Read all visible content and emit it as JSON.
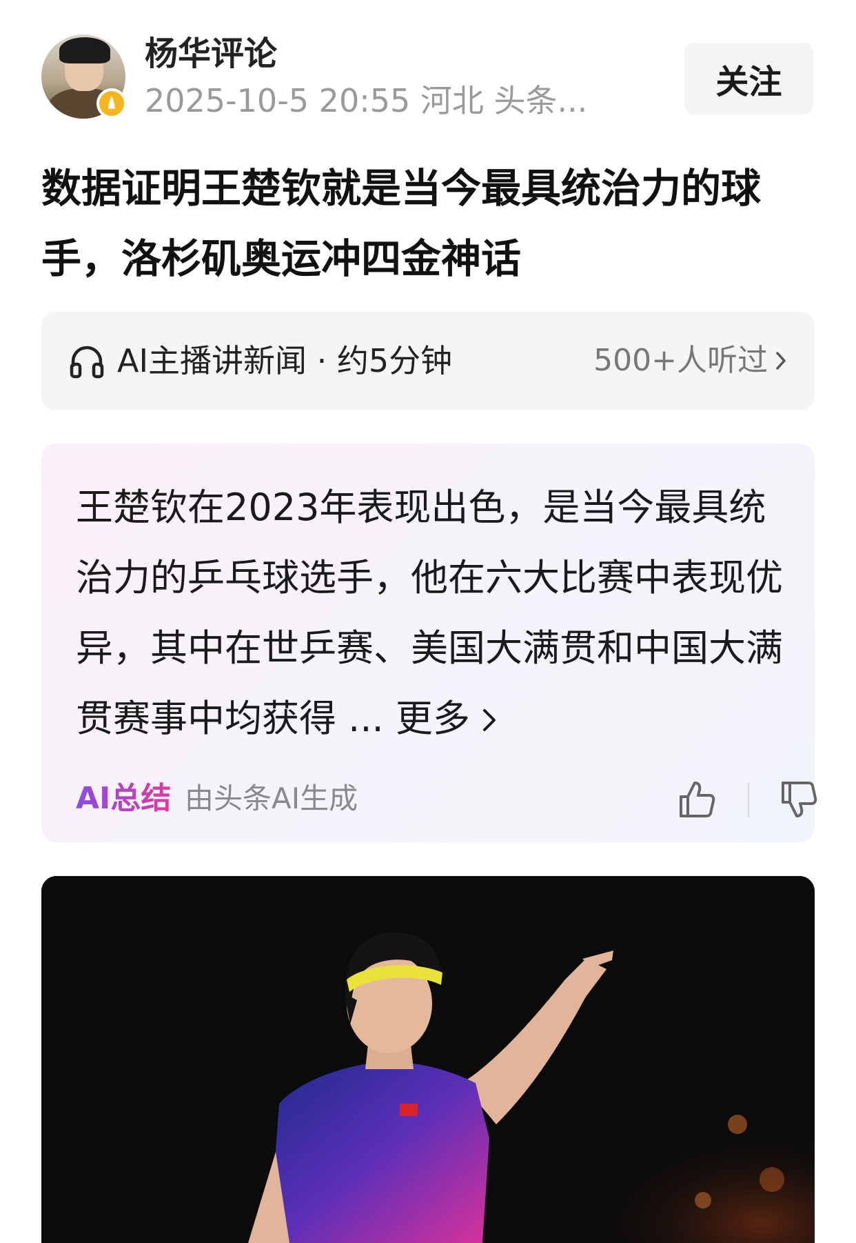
{
  "header": {
    "author": "杨华评论",
    "meta": "2025-10-5 20:55 河北 头条...",
    "follow_label": "关注"
  },
  "article": {
    "title": "数据证明王楚钦就是当今最具统治力的球手，洛杉矶奥运冲四金神话"
  },
  "audio": {
    "label": "AI主播讲新闻 · 约5分钟",
    "listeners": "500+人听过"
  },
  "ai_summary": {
    "text": "王楚钦在2023年表现出色，是当今最具统治力的乒乓球选手，他在六大比赛中表现优异，其中在世乒赛、美国大满贯和中国大满贯赛事中均获得",
    "more_label": "... 更多",
    "label": "AI总结",
    "source": "由头条AI生成"
  },
  "colors": {
    "accent_gradient_start": "#8a4be8",
    "accent_gradient_end": "#e0399b",
    "badge": "#f5b51e"
  },
  "icons": [
    "headphones-icon",
    "chevron-right-icon",
    "thumbs-up-icon",
    "thumbs-down-icon",
    "verified-badge-icon"
  ]
}
